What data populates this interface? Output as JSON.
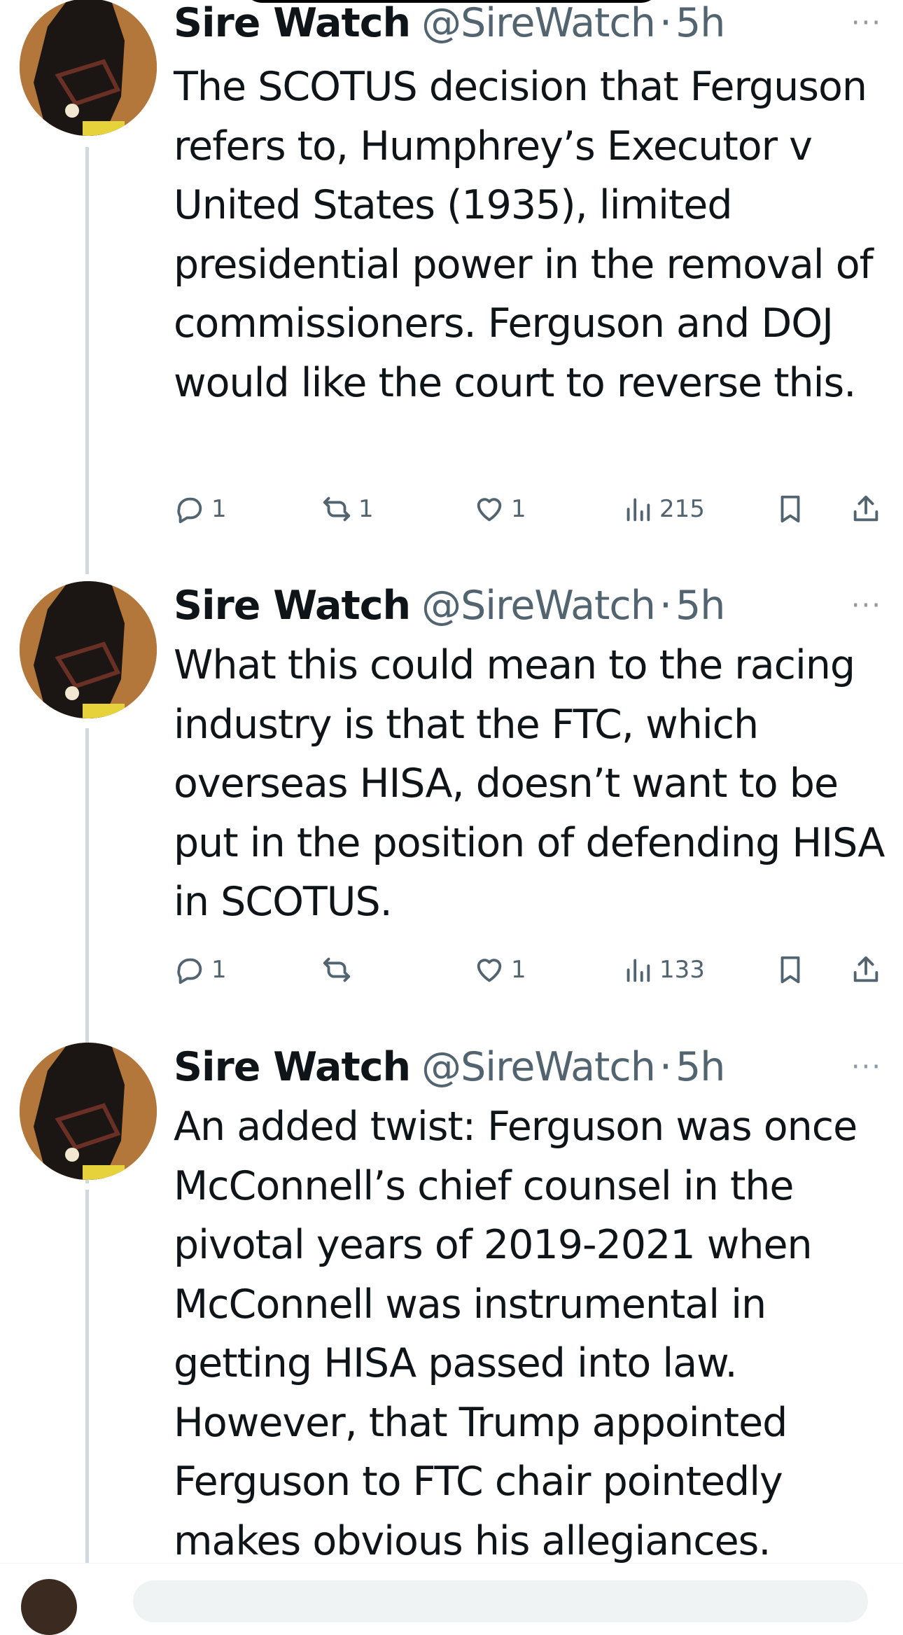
{
  "tweets": [
    {
      "name": "Sire Watch",
      "handle": "@SireWatch",
      "separator": "·",
      "time": "5h",
      "more": "···",
      "text": "The SCOTUS decision that Ferguson refers to, Humphrey’s Executor v United States (1935), limited presidential power in the removal of commissioners. Ferguson and DOJ would like the court to reverse this.",
      "replies": "1",
      "reposts": "1",
      "likes": "1",
      "views": "215"
    },
    {
      "name": "Sire Watch",
      "handle": "@SireWatch",
      "separator": "·",
      "time": "5h",
      "more": "···",
      "text": "What this could mean to the racing industry is that the FTC, which overseas HISA, doesn’t want to be put in the position of defending HISA in SCOTUS.",
      "replies": "1",
      "reposts": "",
      "likes": "1",
      "views": "133"
    },
    {
      "name": "Sire Watch",
      "handle": "@SireWatch",
      "separator": "·",
      "time": "5h",
      "more": "···",
      "text": "An added twist: Ferguson was once McConnell’s chief counsel in the pivotal years of 2019-2021 when McConnell was instrumental in getting HISA passed into law. However, that Trump appointed Ferguson to FTC chair pointedly makes obvious his allegiances.",
      "replies": "",
      "reposts": "",
      "likes": "",
      "views": ""
    }
  ],
  "icons": {
    "reply": "reply-icon",
    "repost": "repost-icon",
    "like": "heart-icon",
    "views": "views-icon",
    "bookmark": "bookmark-icon",
    "share": "share-icon",
    "more": "more-icon"
  },
  "colors": {
    "text": "#0f1419",
    "secondary": "#536471",
    "thread_line": "#cfd9de",
    "avatar": "#b3773b"
  }
}
